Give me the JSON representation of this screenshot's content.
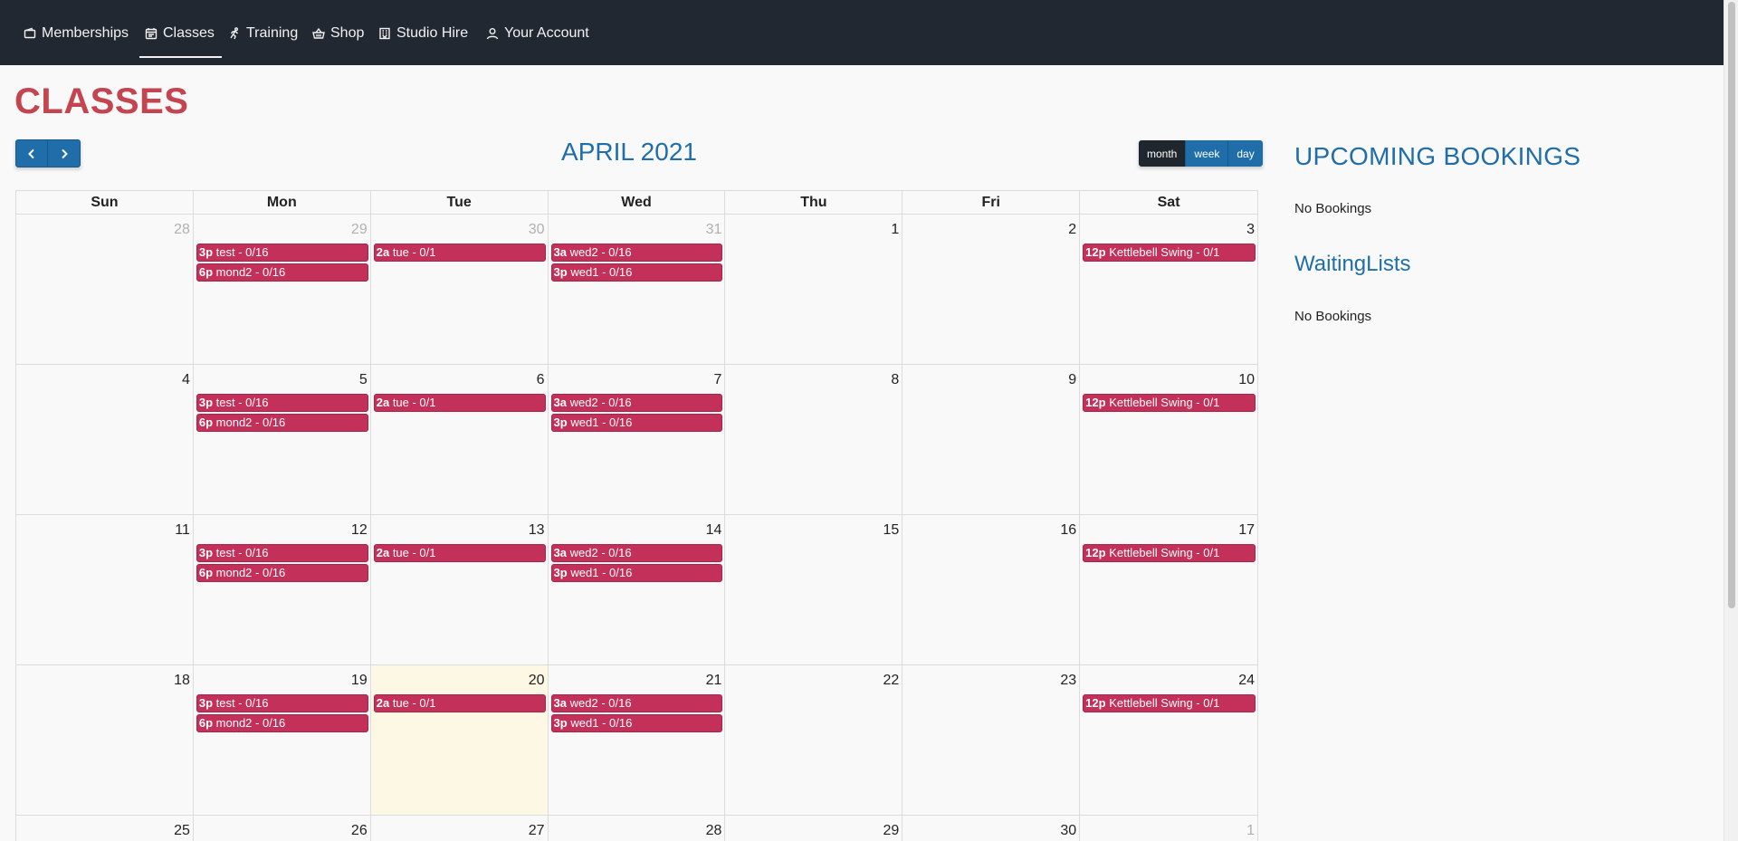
{
  "nav": {
    "items": [
      {
        "label": "Memberships",
        "icon": "wallet-icon"
      },
      {
        "label": "Classes",
        "icon": "calendar-icon",
        "active": true
      },
      {
        "label": "Training",
        "icon": "runner-icon"
      },
      {
        "label": "Shop",
        "icon": "basket-icon"
      },
      {
        "label": "Studio Hire",
        "icon": "building-icon"
      },
      {
        "label": "Your Account",
        "icon": "user-icon"
      }
    ]
  },
  "page": {
    "title": "CLASSES"
  },
  "calendar": {
    "title": "APRIL 2021",
    "views": {
      "month": "month",
      "week": "week",
      "day": "day"
    },
    "weekdays": [
      "Sun",
      "Mon",
      "Tue",
      "Wed",
      "Thu",
      "Fri",
      "Sat"
    ],
    "weeks": [
      [
        {
          "num": "28",
          "other": true,
          "events": []
        },
        {
          "num": "29",
          "other": true,
          "events": [
            {
              "time": "3p",
              "title": "test - 0/16"
            },
            {
              "time": "6p",
              "title": "mond2 - 0/16"
            }
          ]
        },
        {
          "num": "30",
          "other": true,
          "events": [
            {
              "time": "2a",
              "title": "tue - 0/1"
            }
          ]
        },
        {
          "num": "31",
          "other": true,
          "events": [
            {
              "time": "3a",
              "title": "wed2 - 0/16"
            },
            {
              "time": "3p",
              "title": "wed1 - 0/16"
            }
          ]
        },
        {
          "num": "1",
          "events": []
        },
        {
          "num": "2",
          "events": []
        },
        {
          "num": "3",
          "events": [
            {
              "time": "12p",
              "title": "Kettlebell Swing - 0/1"
            }
          ]
        }
      ],
      [
        {
          "num": "4",
          "events": []
        },
        {
          "num": "5",
          "events": [
            {
              "time": "3p",
              "title": "test - 0/16"
            },
            {
              "time": "6p",
              "title": "mond2 - 0/16"
            }
          ]
        },
        {
          "num": "6",
          "events": [
            {
              "time": "2a",
              "title": "tue - 0/1"
            }
          ]
        },
        {
          "num": "7",
          "events": [
            {
              "time": "3a",
              "title": "wed2 - 0/16"
            },
            {
              "time": "3p",
              "title": "wed1 - 0/16"
            }
          ]
        },
        {
          "num": "8",
          "events": []
        },
        {
          "num": "9",
          "events": []
        },
        {
          "num": "10",
          "events": [
            {
              "time": "12p",
              "title": "Kettlebell Swing - 0/1"
            }
          ]
        }
      ],
      [
        {
          "num": "11",
          "events": []
        },
        {
          "num": "12",
          "events": [
            {
              "time": "3p",
              "title": "test - 0/16"
            },
            {
              "time": "6p",
              "title": "mond2 - 0/16"
            }
          ]
        },
        {
          "num": "13",
          "events": [
            {
              "time": "2a",
              "title": "tue - 0/1"
            }
          ]
        },
        {
          "num": "14",
          "events": [
            {
              "time": "3a",
              "title": "wed2 - 0/16"
            },
            {
              "time": "3p",
              "title": "wed1 - 0/16"
            }
          ]
        },
        {
          "num": "15",
          "events": []
        },
        {
          "num": "16",
          "events": []
        },
        {
          "num": "17",
          "events": [
            {
              "time": "12p",
              "title": "Kettlebell Swing - 0/1"
            }
          ]
        }
      ],
      [
        {
          "num": "18",
          "events": []
        },
        {
          "num": "19",
          "events": [
            {
              "time": "3p",
              "title": "test - 0/16"
            },
            {
              "time": "6p",
              "title": "mond2 - 0/16"
            }
          ]
        },
        {
          "num": "20",
          "today": true,
          "events": [
            {
              "time": "2a",
              "title": "tue - 0/1"
            }
          ]
        },
        {
          "num": "21",
          "events": [
            {
              "time": "3a",
              "title": "wed2 - 0/16"
            },
            {
              "time": "3p",
              "title": "wed1 - 0/16"
            }
          ]
        },
        {
          "num": "22",
          "events": []
        },
        {
          "num": "23",
          "events": []
        },
        {
          "num": "24",
          "events": [
            {
              "time": "12p",
              "title": "Kettlebell Swing - 0/1"
            }
          ]
        }
      ],
      [
        {
          "num": "25",
          "events": []
        },
        {
          "num": "26",
          "events": []
        },
        {
          "num": "27",
          "events": []
        },
        {
          "num": "28",
          "events": []
        },
        {
          "num": "29",
          "events": []
        },
        {
          "num": "30",
          "events": []
        },
        {
          "num": "1",
          "other": true,
          "events": []
        }
      ]
    ]
  },
  "sidebar": {
    "upcoming_title": "UPCOMING BOOKINGS",
    "upcoming_empty": "No Bookings",
    "waiting_title": "WaitingLists",
    "waiting_empty": "No Bookings"
  }
}
